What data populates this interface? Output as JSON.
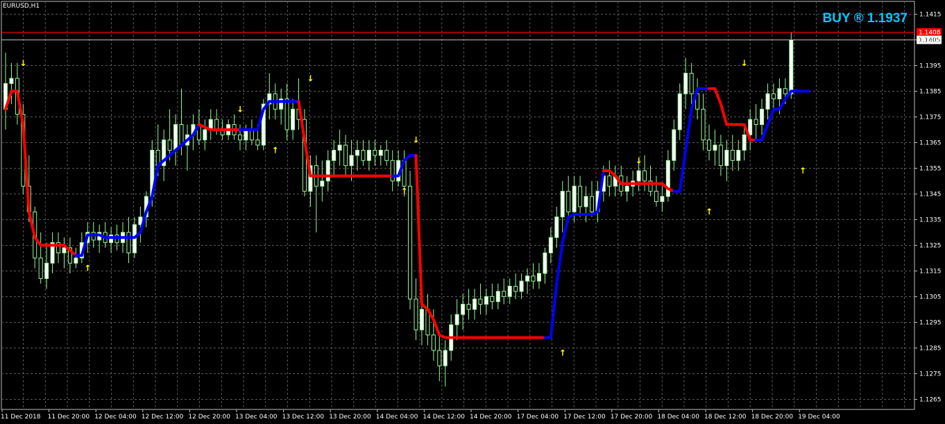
{
  "symbol": "EURUSD,H1",
  "signal": "BUY ® 1.1937",
  "colors": {
    "background": "#000000",
    "grid": "#5a5a5a",
    "bull_candle": "#98fb98",
    "bear_candle": "#ffffff",
    "wick": "#98fb98",
    "trend_up": "#0000ff",
    "trend_down": "#ff0000",
    "arrow": "#ffff00",
    "signal_text": "#00c8ff",
    "price_line": "#ff0000"
  },
  "chart_data": {
    "type": "candlestick",
    "title": "EURUSD,H1",
    "ylim": [
      1.1261,
      1.142
    ],
    "grid": true,
    "y_ticks": [
      "1.1415",
      "1.1405",
      "1.1395",
      "1.1385",
      "1.1375",
      "1.1365",
      "1.1355",
      "1.1345",
      "1.1335",
      "1.1325",
      "1.1315",
      "1.1305",
      "1.1295",
      "1.1285",
      "1.1275",
      "1.1265"
    ],
    "x_ticks": [
      "11 Dec 2018",
      "11 Dec 20:00",
      "12 Dec 04:00",
      "12 Dec 12:00",
      "12 Dec 20:00",
      "13 Dec 04:00",
      "13 Dec 12:00",
      "13 Dec 20:00",
      "14 Dec 04:00",
      "14 Dec 12:00",
      "14 Dec 20:00",
      "17 Dec 04:00",
      "17 Dec 12:00",
      "17 Dec 20:00",
      "18 Dec 04:00",
      "18 Dec 12:00",
      "18 Dec 20:00",
      "19 Dec 04:00"
    ],
    "x_tick_bars": [
      0,
      8,
      16,
      24,
      32,
      40,
      48,
      56,
      64,
      72,
      80,
      88,
      96,
      104,
      112,
      120,
      128,
      136
    ],
    "price_line": {
      "label": "1.1408",
      "value": 1.1408
    },
    "bid_label": {
      "label": "1.1405",
      "value": 1.1405
    },
    "candles": [
      {
        "o": 1.1378,
        "h": 1.14,
        "l": 1.137,
        "c": 1.1388
      },
      {
        "o": 1.1388,
        "h": 1.1396,
        "l": 1.138,
        "c": 1.139
      },
      {
        "o": 1.139,
        "h": 1.1396,
        "l": 1.1372,
        "c": 1.1376
      },
      {
        "o": 1.1376,
        "h": 1.138,
        "l": 1.1345,
        "c": 1.1348
      },
      {
        "o": 1.1348,
        "h": 1.136,
        "l": 1.1334,
        "c": 1.1338
      },
      {
        "o": 1.1338,
        "h": 1.134,
        "l": 1.1316,
        "c": 1.132
      },
      {
        "o": 1.132,
        "h": 1.133,
        "l": 1.131,
        "c": 1.1312
      },
      {
        "o": 1.1312,
        "h": 1.1326,
        "l": 1.1308,
        "c": 1.1318
      },
      {
        "o": 1.1318,
        "h": 1.133,
        "l": 1.1314,
        "c": 1.1326
      },
      {
        "o": 1.1326,
        "h": 1.133,
        "l": 1.1318,
        "c": 1.1322
      },
      {
        "o": 1.1322,
        "h": 1.1328,
        "l": 1.1316,
        "c": 1.1324
      },
      {
        "o": 1.1324,
        "h": 1.1328,
        "l": 1.1314,
        "c": 1.1318
      },
      {
        "o": 1.1318,
        "h": 1.1324,
        "l": 1.1316,
        "c": 1.132
      },
      {
        "o": 1.132,
        "h": 1.133,
        "l": 1.1318,
        "c": 1.1326
      },
      {
        "o": 1.1326,
        "h": 1.1334,
        "l": 1.1322,
        "c": 1.133
      },
      {
        "o": 1.133,
        "h": 1.1334,
        "l": 1.1324,
        "c": 1.1327
      },
      {
        "o": 1.1327,
        "h": 1.1333,
        "l": 1.1322,
        "c": 1.133
      },
      {
        "o": 1.133,
        "h": 1.1334,
        "l": 1.1324,
        "c": 1.1326
      },
      {
        "o": 1.1326,
        "h": 1.1332,
        "l": 1.1322,
        "c": 1.1329
      },
      {
        "o": 1.1329,
        "h": 1.1333,
        "l": 1.1323,
        "c": 1.1326
      },
      {
        "o": 1.1326,
        "h": 1.1334,
        "l": 1.1322,
        "c": 1.133
      },
      {
        "o": 1.133,
        "h": 1.1336,
        "l": 1.1318,
        "c": 1.1322
      },
      {
        "o": 1.1322,
        "h": 1.1336,
        "l": 1.132,
        "c": 1.1333
      },
      {
        "o": 1.1333,
        "h": 1.134,
        "l": 1.1326,
        "c": 1.1336
      },
      {
        "o": 1.1336,
        "h": 1.1346,
        "l": 1.1332,
        "c": 1.1344
      },
      {
        "o": 1.1344,
        "h": 1.1366,
        "l": 1.134,
        "c": 1.1362
      },
      {
        "o": 1.1362,
        "h": 1.1372,
        "l": 1.1352,
        "c": 1.1356
      },
      {
        "o": 1.1356,
        "h": 1.137,
        "l": 1.135,
        "c": 1.1366
      },
      {
        "o": 1.1366,
        "h": 1.1378,
        "l": 1.1358,
        "c": 1.1362
      },
      {
        "o": 1.1362,
        "h": 1.1376,
        "l": 1.1356,
        "c": 1.1372
      },
      {
        "o": 1.1372,
        "h": 1.1386,
        "l": 1.136,
        "c": 1.1364
      },
      {
        "o": 1.1364,
        "h": 1.1372,
        "l": 1.1354,
        "c": 1.1368
      },
      {
        "o": 1.1368,
        "h": 1.1376,
        "l": 1.1362,
        "c": 1.1372
      },
      {
        "o": 1.1372,
        "h": 1.1378,
        "l": 1.1364,
        "c": 1.1366
      },
      {
        "o": 1.1366,
        "h": 1.1374,
        "l": 1.1362,
        "c": 1.137
      },
      {
        "o": 1.137,
        "h": 1.1378,
        "l": 1.1366,
        "c": 1.1374
      },
      {
        "o": 1.1374,
        "h": 1.1378,
        "l": 1.1368,
        "c": 1.137
      },
      {
        "o": 1.137,
        "h": 1.1374,
        "l": 1.1366,
        "c": 1.1368
      },
      {
        "o": 1.1368,
        "h": 1.1374,
        "l": 1.1366,
        "c": 1.1372
      },
      {
        "o": 1.1372,
        "h": 1.1376,
        "l": 1.1366,
        "c": 1.1368
      },
      {
        "o": 1.1368,
        "h": 1.1372,
        "l": 1.1362,
        "c": 1.1366
      },
      {
        "o": 1.1366,
        "h": 1.1372,
        "l": 1.1362,
        "c": 1.137
      },
      {
        "o": 1.137,
        "h": 1.1374,
        "l": 1.1364,
        "c": 1.1366
      },
      {
        "o": 1.1366,
        "h": 1.1372,
        "l": 1.1362,
        "c": 1.1364
      },
      {
        "o": 1.1364,
        "h": 1.1382,
        "l": 1.1362,
        "c": 1.138
      },
      {
        "o": 1.138,
        "h": 1.1392,
        "l": 1.1374,
        "c": 1.1384
      },
      {
        "o": 1.1384,
        "h": 1.1388,
        "l": 1.1374,
        "c": 1.1378
      },
      {
        "o": 1.1378,
        "h": 1.1386,
        "l": 1.1372,
        "c": 1.1382
      },
      {
        "o": 1.1382,
        "h": 1.1388,
        "l": 1.1366,
        "c": 1.137
      },
      {
        "o": 1.137,
        "h": 1.1382,
        "l": 1.1366,
        "c": 1.1378
      },
      {
        "o": 1.1378,
        "h": 1.139,
        "l": 1.137,
        "c": 1.1374
      },
      {
        "o": 1.1374,
        "h": 1.1378,
        "l": 1.1344,
        "c": 1.1346
      },
      {
        "o": 1.1346,
        "h": 1.136,
        "l": 1.134,
        "c": 1.1356
      },
      {
        "o": 1.1356,
        "h": 1.136,
        "l": 1.133,
        "c": 1.1348
      },
      {
        "o": 1.1348,
        "h": 1.1358,
        "l": 1.1342,
        "c": 1.135
      },
      {
        "o": 1.135,
        "h": 1.1362,
        "l": 1.1346,
        "c": 1.1358
      },
      {
        "o": 1.1358,
        "h": 1.1366,
        "l": 1.1352,
        "c": 1.1362
      },
      {
        "o": 1.1362,
        "h": 1.137,
        "l": 1.1356,
        "c": 1.1364
      },
      {
        "o": 1.1364,
        "h": 1.1368,
        "l": 1.1352,
        "c": 1.1356
      },
      {
        "o": 1.1356,
        "h": 1.1366,
        "l": 1.135,
        "c": 1.136
      },
      {
        "o": 1.136,
        "h": 1.1366,
        "l": 1.1354,
        "c": 1.1362
      },
      {
        "o": 1.1362,
        "h": 1.1366,
        "l": 1.1356,
        "c": 1.1358
      },
      {
        "o": 1.1358,
        "h": 1.1366,
        "l": 1.1354,
        "c": 1.1362
      },
      {
        "o": 1.1362,
        "h": 1.1366,
        "l": 1.1356,
        "c": 1.136
      },
      {
        "o": 1.136,
        "h": 1.1364,
        "l": 1.1356,
        "c": 1.1362
      },
      {
        "o": 1.1362,
        "h": 1.1366,
        "l": 1.1356,
        "c": 1.1358
      },
      {
        "o": 1.1358,
        "h": 1.1362,
        "l": 1.1346,
        "c": 1.135
      },
      {
        "o": 1.135,
        "h": 1.1362,
        "l": 1.1348,
        "c": 1.1358
      },
      {
        "o": 1.1358,
        "h": 1.1362,
        "l": 1.1344,
        "c": 1.1348
      },
      {
        "o": 1.1348,
        "h": 1.1354,
        "l": 1.13,
        "c": 1.1304
      },
      {
        "o": 1.1304,
        "h": 1.1312,
        "l": 1.1288,
        "c": 1.1292
      },
      {
        "o": 1.1292,
        "h": 1.1304,
        "l": 1.1286,
        "c": 1.13
      },
      {
        "o": 1.13,
        "h": 1.1306,
        "l": 1.1286,
        "c": 1.129
      },
      {
        "o": 1.129,
        "h": 1.13,
        "l": 1.128,
        "c": 1.1284
      },
      {
        "o": 1.1284,
        "h": 1.129,
        "l": 1.1272,
        "c": 1.1278
      },
      {
        "o": 1.1278,
        "h": 1.1288,
        "l": 1.127,
        "c": 1.1284
      },
      {
        "o": 1.1284,
        "h": 1.1298,
        "l": 1.128,
        "c": 1.1294
      },
      {
        "o": 1.1294,
        "h": 1.1304,
        "l": 1.1288,
        "c": 1.1298
      },
      {
        "o": 1.1298,
        "h": 1.1306,
        "l": 1.1292,
        "c": 1.1302
      },
      {
        "o": 1.1302,
        "h": 1.1308,
        "l": 1.1296,
        "c": 1.13
      },
      {
        "o": 1.13,
        "h": 1.1308,
        "l": 1.1296,
        "c": 1.1304
      },
      {
        "o": 1.1304,
        "h": 1.131,
        "l": 1.1298,
        "c": 1.1302
      },
      {
        "o": 1.1302,
        "h": 1.1308,
        "l": 1.1298,
        "c": 1.1305
      },
      {
        "o": 1.1305,
        "h": 1.131,
        "l": 1.13,
        "c": 1.1303
      },
      {
        "o": 1.1303,
        "h": 1.131,
        "l": 1.13,
        "c": 1.1307
      },
      {
        "o": 1.1307,
        "h": 1.1312,
        "l": 1.1302,
        "c": 1.1305
      },
      {
        "o": 1.1305,
        "h": 1.1312,
        "l": 1.1302,
        "c": 1.1309
      },
      {
        "o": 1.1309,
        "h": 1.1314,
        "l": 1.1304,
        "c": 1.1307
      },
      {
        "o": 1.1307,
        "h": 1.1314,
        "l": 1.1304,
        "c": 1.1311
      },
      {
        "o": 1.1311,
        "h": 1.1316,
        "l": 1.1306,
        "c": 1.1313
      },
      {
        "o": 1.1313,
        "h": 1.1318,
        "l": 1.1308,
        "c": 1.1311
      },
      {
        "o": 1.1311,
        "h": 1.1318,
        "l": 1.1308,
        "c": 1.1314
      },
      {
        "o": 1.1314,
        "h": 1.1324,
        "l": 1.131,
        "c": 1.1322
      },
      {
        "o": 1.1322,
        "h": 1.1332,
        "l": 1.1318,
        "c": 1.1328
      },
      {
        "o": 1.1328,
        "h": 1.134,
        "l": 1.1324,
        "c": 1.1336
      },
      {
        "o": 1.1336,
        "h": 1.135,
        "l": 1.133,
        "c": 1.1346
      },
      {
        "o": 1.1346,
        "h": 1.1352,
        "l": 1.1334,
        "c": 1.1338
      },
      {
        "o": 1.1338,
        "h": 1.1352,
        "l": 1.1334,
        "c": 1.1348
      },
      {
        "o": 1.1348,
        "h": 1.1352,
        "l": 1.1336,
        "c": 1.134
      },
      {
        "o": 1.134,
        "h": 1.1348,
        "l": 1.1334,
        "c": 1.1344
      },
      {
        "o": 1.1344,
        "h": 1.135,
        "l": 1.1336,
        "c": 1.1338
      },
      {
        "o": 1.1338,
        "h": 1.135,
        "l": 1.1334,
        "c": 1.1346
      },
      {
        "o": 1.1346,
        "h": 1.1356,
        "l": 1.1342,
        "c": 1.1352
      },
      {
        "o": 1.1352,
        "h": 1.1358,
        "l": 1.1344,
        "c": 1.1348
      },
      {
        "o": 1.1348,
        "h": 1.1356,
        "l": 1.1344,
        "c": 1.1352
      },
      {
        "o": 1.1352,
        "h": 1.1356,
        "l": 1.1344,
        "c": 1.1346
      },
      {
        "o": 1.1346,
        "h": 1.1352,
        "l": 1.1342,
        "c": 1.1348
      },
      {
        "o": 1.1348,
        "h": 1.1354,
        "l": 1.1344,
        "c": 1.135
      },
      {
        "o": 1.135,
        "h": 1.1358,
        "l": 1.1346,
        "c": 1.1354
      },
      {
        "o": 1.1354,
        "h": 1.136,
        "l": 1.1346,
        "c": 1.135
      },
      {
        "o": 1.135,
        "h": 1.1356,
        "l": 1.1344,
        "c": 1.1346
      },
      {
        "o": 1.1346,
        "h": 1.1352,
        "l": 1.134,
        "c": 1.1342
      },
      {
        "o": 1.1342,
        "h": 1.1348,
        "l": 1.1338,
        "c": 1.1344
      },
      {
        "o": 1.1344,
        "h": 1.1362,
        "l": 1.1342,
        "c": 1.1358
      },
      {
        "o": 1.1358,
        "h": 1.1374,
        "l": 1.1354,
        "c": 1.137
      },
      {
        "o": 1.137,
        "h": 1.1388,
        "l": 1.1366,
        "c": 1.1384
      },
      {
        "o": 1.1384,
        "h": 1.1398,
        "l": 1.1378,
        "c": 1.1392
      },
      {
        "o": 1.1392,
        "h": 1.1396,
        "l": 1.138,
        "c": 1.1384
      },
      {
        "o": 1.1384,
        "h": 1.139,
        "l": 1.1374,
        "c": 1.1378
      },
      {
        "o": 1.1378,
        "h": 1.1384,
        "l": 1.1362,
        "c": 1.1366
      },
      {
        "o": 1.1366,
        "h": 1.1372,
        "l": 1.1358,
        "c": 1.1362
      },
      {
        "o": 1.1362,
        "h": 1.137,
        "l": 1.1356,
        "c": 1.1364
      },
      {
        "o": 1.1364,
        "h": 1.1368,
        "l": 1.1352,
        "c": 1.1356
      },
      {
        "o": 1.1356,
        "h": 1.1366,
        "l": 1.135,
        "c": 1.1362
      },
      {
        "o": 1.1362,
        "h": 1.1368,
        "l": 1.1354,
        "c": 1.1358
      },
      {
        "o": 1.1358,
        "h": 1.1366,
        "l": 1.1354,
        "c": 1.1362
      },
      {
        "o": 1.1362,
        "h": 1.1372,
        "l": 1.1358,
        "c": 1.1368
      },
      {
        "o": 1.1368,
        "h": 1.1378,
        "l": 1.1362,
        "c": 1.1374
      },
      {
        "o": 1.1374,
        "h": 1.138,
        "l": 1.1366,
        "c": 1.1372
      },
      {
        "o": 1.1372,
        "h": 1.1382,
        "l": 1.1368,
        "c": 1.1378
      },
      {
        "o": 1.1378,
        "h": 1.1388,
        "l": 1.1374,
        "c": 1.1384
      },
      {
        "o": 1.1384,
        "h": 1.1388,
        "l": 1.1378,
        "c": 1.1382
      },
      {
        "o": 1.1382,
        "h": 1.139,
        "l": 1.1376,
        "c": 1.1386
      },
      {
        "o": 1.1386,
        "h": 1.139,
        "l": 1.138,
        "c": 1.1384
      },
      {
        "o": 1.1384,
        "h": 1.1408,
        "l": 1.1382,
        "c": 1.1405
      }
    ],
    "trend_line": [
      1.1378,
      1.1385,
      1.1385,
      1.1372,
      1.1338,
      1.1328,
      1.1325,
      1.1325,
      1.1325,
      1.1325,
      1.1325,
      1.1323,
      1.1321,
      1.1321,
      1.1329,
      1.1329,
      1.1329,
      1.1328,
      1.1328,
      1.1328,
      1.1328,
      1.1328,
      1.1328,
      1.133,
      1.1338,
      1.1344,
      1.1356,
      1.1358,
      1.136,
      1.1362,
      1.1364,
      1.1366,
      1.1368,
      1.1372,
      1.1371,
      1.137,
      1.137,
      1.137,
      1.137,
      1.137,
      1.137,
      1.137,
      1.137,
      1.137,
      1.1378,
      1.1381,
      1.1381,
      1.1381,
      1.1381,
      1.1381,
      1.1381,
      1.1366,
      1.1352,
      1.1352,
      1.1352,
      1.1352,
      1.1352,
      1.1352,
      1.1352,
      1.1352,
      1.1352,
      1.1352,
      1.1352,
      1.1352,
      1.1352,
      1.1352,
      1.1352,
      1.1352,
      1.1358,
      1.136,
      1.136,
      1.1302,
      1.13,
      1.1296,
      1.129,
      1.1289,
      1.1289,
      1.1289,
      1.1289,
      1.1289,
      1.1289,
      1.1289,
      1.1289,
      1.1289,
      1.1289,
      1.1289,
      1.1289,
      1.1289,
      1.1289,
      1.1289,
      1.1289,
      1.1289,
      1.1289,
      1.1289,
      1.131,
      1.1326,
      1.1336,
      1.1337,
      1.1337,
      1.1337,
      1.1337,
      1.1338,
      1.1354,
      1.1354,
      1.1352,
      1.1349,
      1.1349,
      1.1349,
      1.1349,
      1.1349,
      1.1349,
      1.1349,
      1.1349,
      1.1347,
      1.1346,
      1.1346,
      1.1362,
      1.1378,
      1.1386,
      1.1386,
      1.1386,
      1.1386,
      1.138,
      1.1372,
      1.1372,
      1.1372,
      1.1372,
      1.1366,
      1.1366,
      1.1366,
      1.1372,
      1.1378,
      1.1378,
      1.1382,
      1.1385,
      1.1385,
      1.1385,
      1.1385
    ],
    "trend_direction": [
      "up",
      "down",
      "down",
      "down",
      "down",
      "down",
      "down",
      "down",
      "down",
      "down",
      "down",
      "down",
      "down",
      "up",
      "up",
      "up",
      "up",
      "up",
      "up",
      "up",
      "up",
      "up",
      "up",
      "up",
      "up",
      "up",
      "up",
      "up",
      "up",
      "up",
      "up",
      "up",
      "up",
      "up",
      "down",
      "down",
      "down",
      "down",
      "down",
      "down",
      "down",
      "up",
      "up",
      "up",
      "up",
      "up",
      "up",
      "up",
      "up",
      "up",
      "up",
      "down",
      "down",
      "down",
      "down",
      "down",
      "down",
      "down",
      "down",
      "down",
      "down",
      "down",
      "down",
      "down",
      "down",
      "down",
      "down",
      "up",
      "up",
      "up",
      "up",
      "down",
      "down",
      "down",
      "down",
      "down",
      "down",
      "down",
      "down",
      "down",
      "down",
      "down",
      "down",
      "down",
      "down",
      "down",
      "down",
      "down",
      "down",
      "down",
      "down",
      "down",
      "down",
      "up",
      "up",
      "up",
      "up",
      "up",
      "up",
      "up",
      "up",
      "up",
      "up",
      "down",
      "down",
      "down",
      "down",
      "down",
      "down",
      "down",
      "down",
      "down",
      "down",
      "down",
      "down",
      "up",
      "up",
      "up",
      "up",
      "up",
      "up",
      "down",
      "down",
      "down",
      "down",
      "down",
      "down",
      "down",
      "down",
      "up",
      "up",
      "up",
      "up",
      "up",
      "up",
      "up",
      "up",
      "up"
    ],
    "arrows": [
      {
        "bar": 3,
        "dir": "down",
        "price": 1.1396
      },
      {
        "bar": 14,
        "dir": "up",
        "price": 1.1316
      },
      {
        "bar": 40,
        "dir": "down",
        "price": 1.1378
      },
      {
        "bar": 46,
        "dir": "up",
        "price": 1.1362
      },
      {
        "bar": 52,
        "dir": "down",
        "price": 1.139
      },
      {
        "bar": 68,
        "dir": "up",
        "price": 1.1346
      },
      {
        "bar": 70,
        "dir": "down",
        "price": 1.1366
      },
      {
        "bar": 95,
        "dir": "up",
        "price": 1.1283
      },
      {
        "bar": 108,
        "dir": "down",
        "price": 1.1358
      },
      {
        "bar": 120,
        "dir": "up",
        "price": 1.1338
      },
      {
        "bar": 126,
        "dir": "down",
        "price": 1.1396
      },
      {
        "bar": 136,
        "dir": "up",
        "price": 1.1354
      }
    ]
  }
}
